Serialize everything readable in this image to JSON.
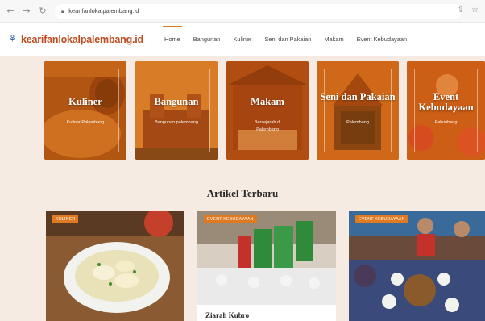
{
  "browser": {
    "url": "kearifanlokalpalembang.id",
    "back_icon": "arrow-left",
    "forward_icon": "arrow-right",
    "reload_icon": "reload",
    "lock_icon": "lock",
    "share_icon": "share",
    "star_icon": "star"
  },
  "site": {
    "logo_text": "kearifanlokalpalembang.id",
    "accent": "#e07a22",
    "menu": [
      "Home",
      "Bangunan",
      "Kuliner",
      "Seni dan Pakaian",
      "Makam",
      "Event Kebudayaan"
    ]
  },
  "categories": [
    {
      "title": "Kuliner",
      "subtitle": "Kuliner Palembang"
    },
    {
      "title": "Bangunan",
      "subtitle": "Bangunan palembang"
    },
    {
      "title": "Makam",
      "subtitle": "Bersejarah di Palembang"
    },
    {
      "title": "Seni dan Pakaian",
      "subtitle": "Palembang"
    },
    {
      "title": "Event Kebudayaan",
      "subtitle": "Palembang"
    }
  ],
  "section": {
    "title": "Artikel Terbaru"
  },
  "articles": [
    {
      "badge": "KULINER",
      "title": ""
    },
    {
      "badge": "EVENT KEBUDAYAAN",
      "title": "Ziarah Kubro"
    },
    {
      "badge": "EVENT KEBUDAYAAN",
      "title": ""
    }
  ]
}
